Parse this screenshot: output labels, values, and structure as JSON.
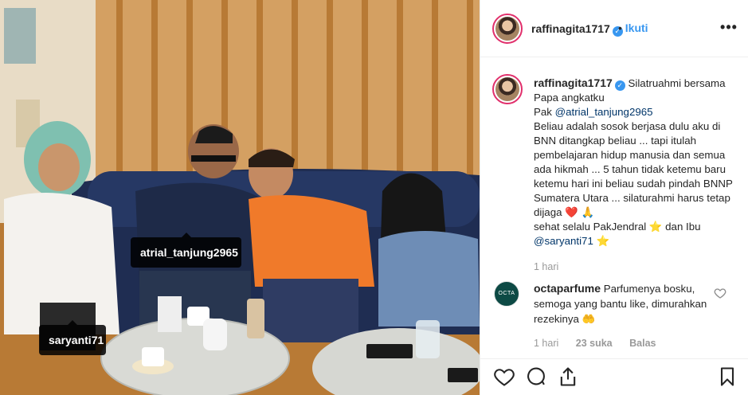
{
  "photo": {
    "alt": "",
    "tags": {
      "atrial": "atrial_tanjung2965",
      "saryanti": "saryanti71"
    }
  },
  "header": {
    "username": "raffinagita1717",
    "separator": "•",
    "follow_label": "Ikuti",
    "more_icon": "more-options-icon"
  },
  "caption": {
    "username": "raffinagita1717",
    "line1": "Silatruahmi bersama Papa angkatku",
    "line2_prefix": "Pak ",
    "line2_mention": "@atrial_tanjung2965",
    "body": "Beliau adalah sosok berjasa dulu aku di BNN ditangkap beliau ... tapi itulah pembelajaran hidup manusia dan semua ada hikmah ... 5 tahun tidak ketemu baru ketemu hari ini beliau sudah pindah BNNP Sumatera Utara ... silaturahmi harus tetap dijaga",
    "body2": "sehat selalu PakJendral",
    "body3": "dan Ibu",
    "mention2": "@saryanti71",
    "emoji_heart": "❤️",
    "emoji_pray": "🙏",
    "emoji_star": "⭐",
    "time": "1 hari"
  },
  "comments": [
    {
      "avatar_text": "OCTA",
      "username": "octaparfume",
      "text": "Parfumenya bosku, semoga yang bantu like, dimurahkan rezekinya",
      "emoji": "🤲",
      "time": "1 hari",
      "likes": "23 suka",
      "reply_label": "Balas"
    }
  ],
  "colors": {
    "accent": "#3897f0",
    "link": "#003569",
    "ring": "#e1306c",
    "meta": "#999999"
  },
  "icons": [
    "heart-icon",
    "comment-icon",
    "share-icon",
    "bookmark-icon",
    "verified-icon"
  ]
}
